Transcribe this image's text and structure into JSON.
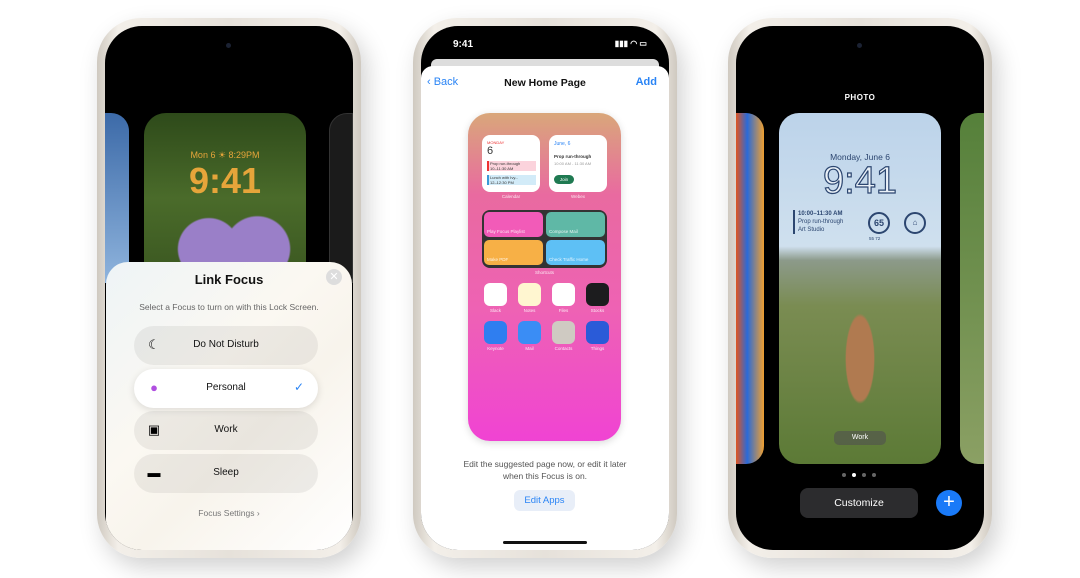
{
  "left_phone": {
    "lock_date": "Mon 6 ☀ 8:29PM",
    "lock_time": "9:41",
    "sheet": {
      "title": "Link Focus",
      "subtitle": "Select a Focus to turn on with this Lock Screen.",
      "options": [
        {
          "label": "Do Not Disturb",
          "icon": "moon-icon",
          "selected": false
        },
        {
          "label": "Personal",
          "icon": "person-icon",
          "selected": true
        },
        {
          "label": "Work",
          "icon": "id-badge-icon",
          "selected": false
        },
        {
          "label": "Sleep",
          "icon": "bed-icon",
          "selected": false
        }
      ],
      "footer": "Focus Settings ›",
      "close": "✕",
      "check": "✓"
    }
  },
  "middle_phone": {
    "status_time": "9:41",
    "status_icons": "▮▮▮ ◠ ▭",
    "nav": {
      "back": "‹ Back",
      "title": "New Home Page",
      "add": "Add"
    },
    "calendar": {
      "day": "MONDAY",
      "date": "6",
      "events": [
        {
          "title": "Prop run-through",
          "time": "10–11:30 AM"
        },
        {
          "title": "Lunch with Ivy...",
          "time": "12–12:30 PM"
        }
      ],
      "caption": "Calendar"
    },
    "webex": {
      "date": "June, 6",
      "title": "Prop run-through",
      "time": "10:00 AM - 11:30 AM",
      "join": "Join",
      "caption": "Webex"
    },
    "shortcuts": {
      "items": [
        {
          "label": "Play Focus Playlist",
          "color": "#f25bb8"
        },
        {
          "label": "Compose Mail",
          "color": "#5fb8a6"
        },
        {
          "label": "Make PDF",
          "color": "#f7b046"
        },
        {
          "label": "Check Traffic Home",
          "color": "#5ec0f5"
        }
      ],
      "caption": "Shortcuts"
    },
    "apps": [
      {
        "label": "Slack",
        "color": "#ffffff"
      },
      {
        "label": "Notes",
        "color": "#fff6d0"
      },
      {
        "label": "Files",
        "color": "#ffffff"
      },
      {
        "label": "Stocks",
        "color": "#1c1c1e"
      },
      {
        "label": "Keynote",
        "color": "#2f7ef0"
      },
      {
        "label": "Mail",
        "color": "#3a8df5"
      },
      {
        "label": "Contacts",
        "color": "#cfcac2"
      },
      {
        "label": "Things",
        "color": "#2a5bd8"
      }
    ],
    "description": "Edit the suggested page now, or edit it later when this Focus is on.",
    "edit_apps": "Edit Apps"
  },
  "right_phone": {
    "label": "PHOTO",
    "date": "Monday, June 6",
    "time": "9:41",
    "event": {
      "time": "10:00–11:30 AM",
      "title": "Prop run-through",
      "location": "Art Studio"
    },
    "weather": {
      "temp": "65",
      "range": "55  72"
    },
    "focus_badge": "Work",
    "customize": "Customize",
    "add": "+",
    "page_dots": 5,
    "active_dot": 2
  }
}
